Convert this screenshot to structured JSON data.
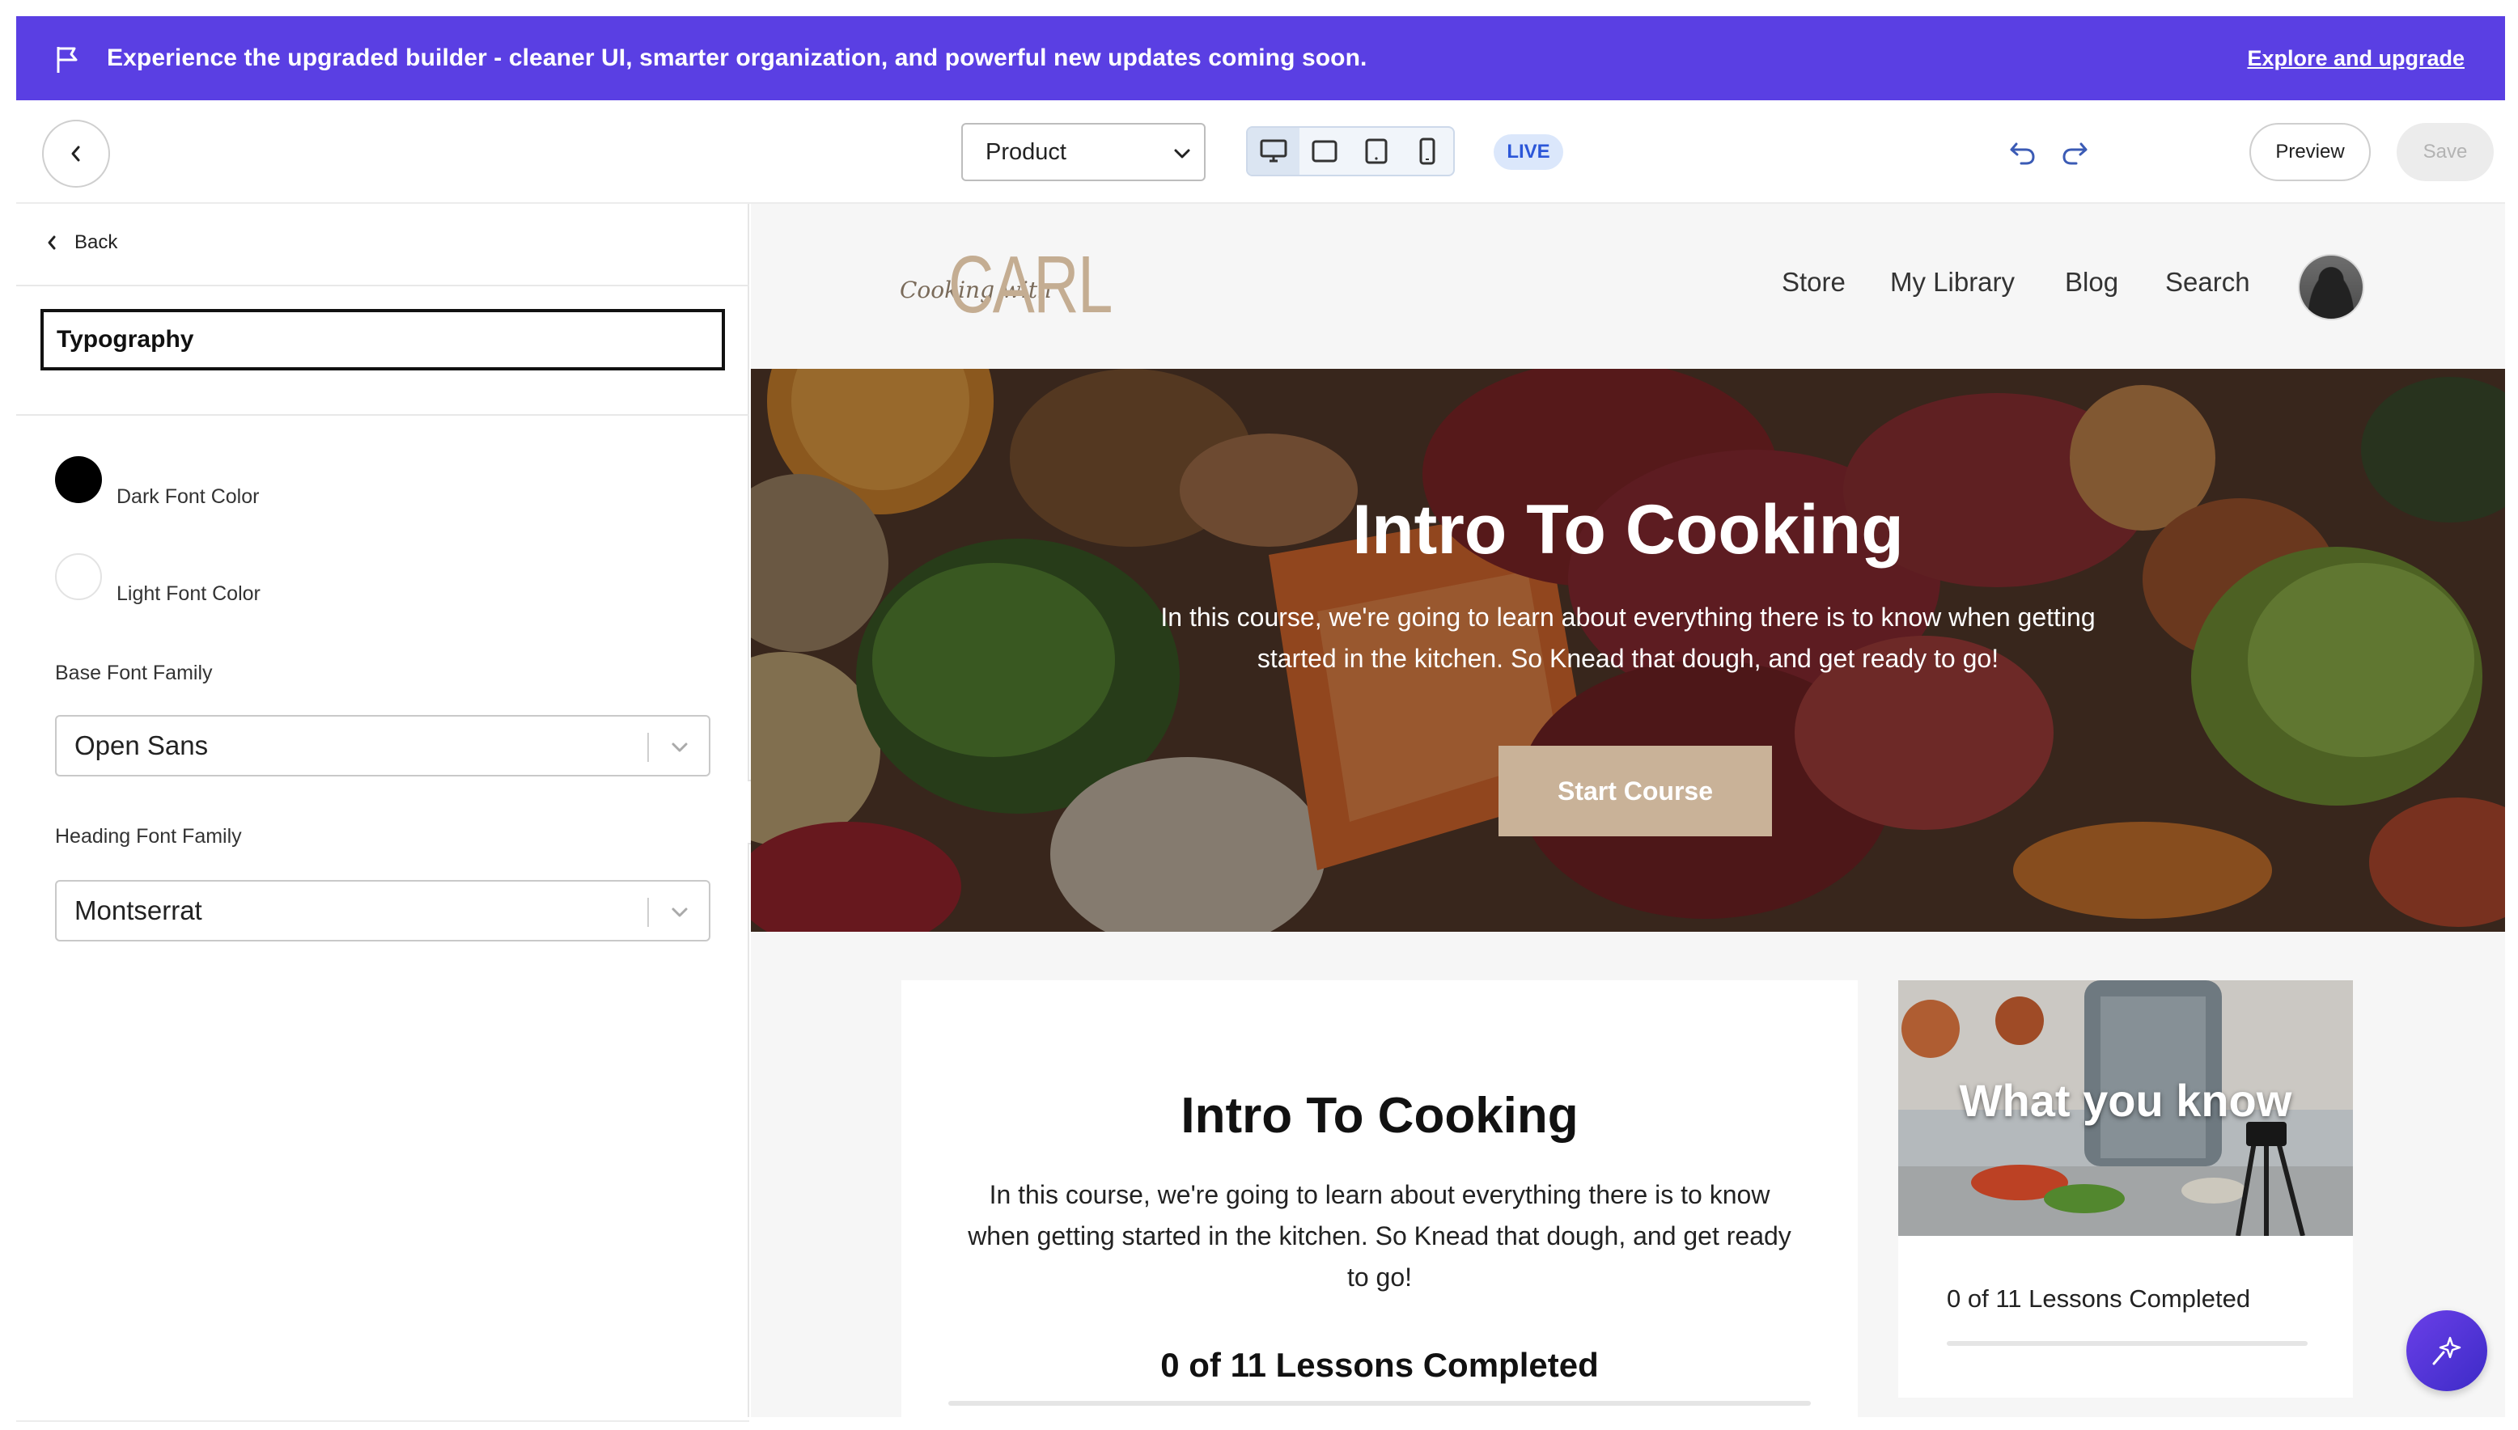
{
  "banner": {
    "message": "Experience the upgraded builder - cleaner UI, smarter organization, and powerful new updates coming soon.",
    "link": "Explore and upgrade"
  },
  "toolbar": {
    "page_select": "Product",
    "live_badge": "LIVE",
    "preview_label": "Preview",
    "save_label": "Save"
  },
  "panel": {
    "back_label": "Back",
    "section_title": "Typography",
    "dark_font_label": "Dark Font Color",
    "dark_font_color": "#000000",
    "light_font_label": "Light Font Color",
    "light_font_color": "#ffffff",
    "base_font_label": "Base Font Family",
    "base_font_value": "Open Sans",
    "heading_font_label": "Heading Font Family",
    "heading_font_value": "Montserrat"
  },
  "site": {
    "logo_script": "Cooking with",
    "logo_main": "CARL",
    "nav": [
      "Store",
      "My Library",
      "Blog",
      "Search"
    ],
    "hero_title": "Intro To Cooking",
    "hero_desc": "In this course, we're going to learn about everything there is to know when getting started in the kitchen. So Knead that dough, and get ready to go!",
    "hero_button": "Start Course",
    "card_title": "Intro To Cooking",
    "card_desc": "In this course, we're going to learn about everything there is to know when getting started in the kitchen. So Knead that dough, and get ready to go!",
    "card_progress": "0 of 11 Lessons Completed",
    "side_title": "What you know",
    "side_progress": "0 of 11 Lessons Completed",
    "accent_color": "#c9b298"
  },
  "colors": {
    "banner": "#5a3fe3",
    "live": "#2b56d8"
  }
}
